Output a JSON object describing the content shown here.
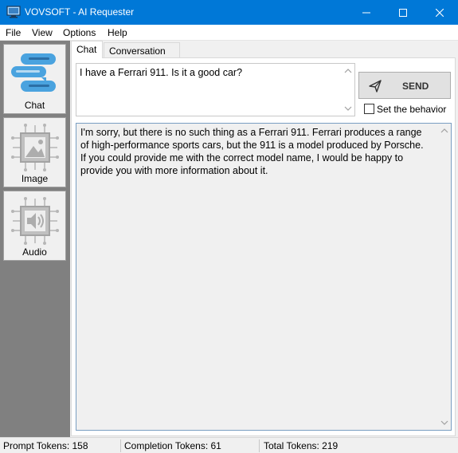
{
  "window": {
    "title": "VOVSOFT - AI Requester",
    "minimize_icon": "minimize-icon",
    "maximize_icon": "maximize-icon",
    "close_icon": "close-icon"
  },
  "menu": [
    "File",
    "View",
    "Options",
    "Help"
  ],
  "sidebar": {
    "items": [
      {
        "label": "Chat",
        "icon": "chat-bubbles-icon"
      },
      {
        "label": "Image",
        "icon": "image-chip-icon"
      },
      {
        "label": "Audio",
        "icon": "audio-chip-icon"
      }
    ]
  },
  "tabs": [
    "Chat",
    "Conversation Log"
  ],
  "chat": {
    "prompt_value": "I have a Ferrari 911. Is it a good car?",
    "send_label": "SEND",
    "set_behavior_label": "Set the behavior",
    "set_behavior_checked": false,
    "response_value": "I'm sorry, but there is no such thing as a Ferrari 911. Ferrari produces a range of high-performance sports cars, but the 911 is a model produced by Porsche. If you could provide me with the correct model name, I would be happy to provide you with more information about it."
  },
  "status": {
    "prompt_tokens": "Prompt Tokens: 158",
    "completion_tokens": "Completion Tokens: 61",
    "total_tokens": "Total Tokens: 219"
  },
  "colors": {
    "titlebar": "#0078d7",
    "accent_blue": "#4aa3df",
    "sidebar_bg": "#808080"
  }
}
